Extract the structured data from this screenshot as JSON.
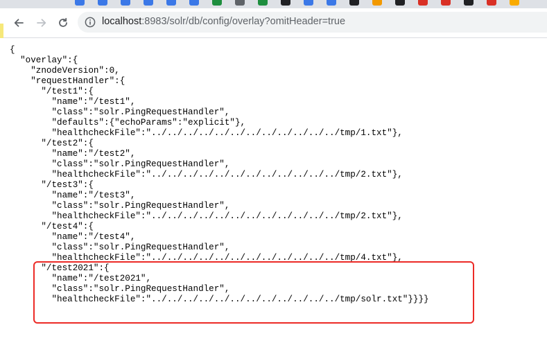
{
  "browser": {
    "url_host": "localhost",
    "url_rest": ":8983/solr/db/config/overlay?omitHeader=true",
    "tab_colors": [
      "#3b78e7",
      "#3b78e7",
      "#3b78e7",
      "#3b78e7",
      "#3b78e7",
      "#3b78e7",
      "#1e8e3e",
      "#5f6368",
      "#1e8e3e",
      "#202124",
      "#3b78e7",
      "#3b78e7",
      "#202124",
      "#f29900",
      "#202124",
      "#d93025",
      "#d93025",
      "#202124",
      "#d93025",
      "#f9ab00"
    ]
  },
  "document": {
    "lines": [
      "{",
      "  \"overlay\":{",
      "    \"znodeVersion\":0,",
      "    \"requestHandler\":{",
      "      \"/test1\":{",
      "        \"name\":\"/test1\",",
      "        \"class\":\"solr.PingRequestHandler\",",
      "        \"defaults\":{\"echoParams\":\"explicit\"},",
      "        \"healthcheckFile\":\"../../../../../../../../../../../../tmp/1.txt\"},",
      "      \"/test2\":{",
      "        \"name\":\"/test2\",",
      "        \"class\":\"solr.PingRequestHandler\",",
      "        \"healthcheckFile\":\"../../../../../../../../../../../../tmp/2.txt\"},",
      "      \"/test3\":{",
      "        \"name\":\"/test3\",",
      "        \"class\":\"solr.PingRequestHandler\",",
      "        \"healthcheckFile\":\"../../../../../../../../../../../../tmp/2.txt\"},",
      "      \"/test4\":{",
      "        \"name\":\"/test4\",",
      "        \"class\":\"solr.PingRequestHandler\",",
      "        \"healthcheckFile\":\"../../../../../../../../../../../../tmp/4.txt\"},",
      "      \"/test2021\":{",
      "        \"name\":\"/test2021\",",
      "        \"class\":\"solr.PingRequestHandler\",",
      "        \"healthcheckFile\":\"../../../../../../../../../../../../tmp/solr.txt\"}}}}"
    ]
  },
  "annotation": {
    "color": "#ec2a26"
  }
}
